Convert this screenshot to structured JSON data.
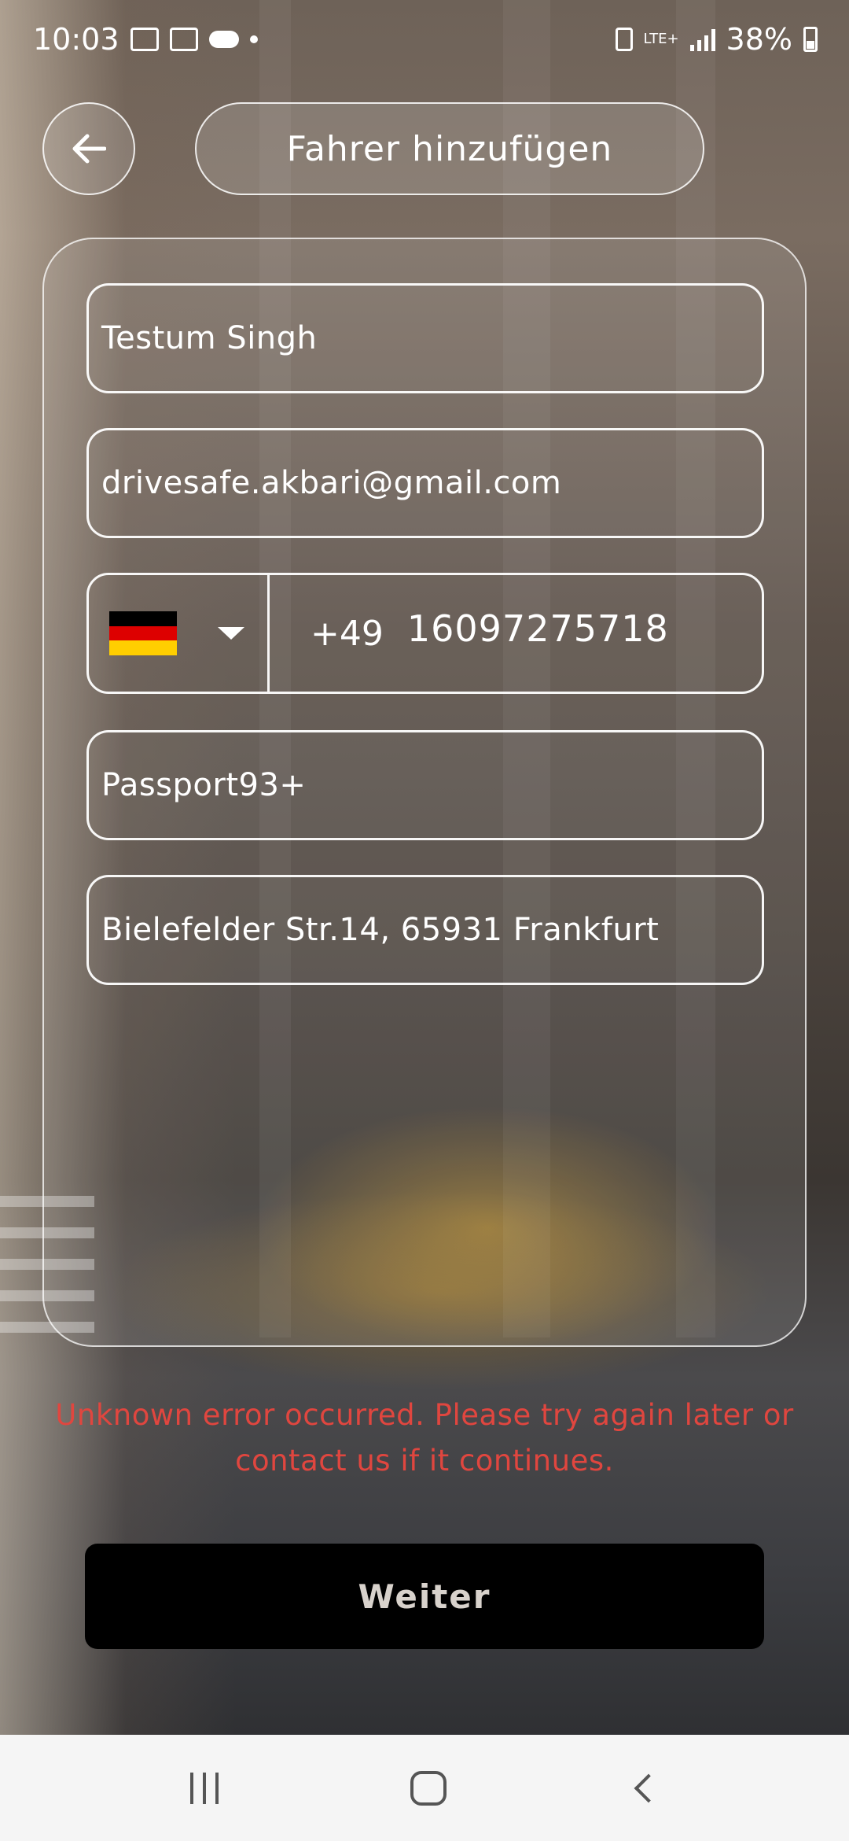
{
  "status_bar": {
    "time": "10:03",
    "network": "LTE+",
    "battery": "38%"
  },
  "header": {
    "back_icon": "arrow-left-icon",
    "title": "Fahrer hinzufügen"
  },
  "form": {
    "name_value": "Testum Singh",
    "email_value": "drivesafe.akbari@gmail.com",
    "phone": {
      "country_flag": "germany-flag-icon",
      "dial_code": "+49",
      "number": "16097275718"
    },
    "passport_value": "Passport93+",
    "address_value": "Bielefelder Str.14, 65931 Frankfurt"
  },
  "error": {
    "message": "Unknown error occurred. Please try again later or contact us if it continues.",
    "color": "#e0463f"
  },
  "actions": {
    "next_label": "Weiter"
  },
  "colors": {
    "primary_button": "#000000",
    "error": "#e0463f",
    "flag_black": "#000000",
    "flag_red": "#dd0000",
    "flag_gold": "#ffce00"
  },
  "nav_bar": {
    "recent_icon": "recent-apps-icon",
    "home_icon": "home-icon",
    "back_icon": "back-icon"
  }
}
